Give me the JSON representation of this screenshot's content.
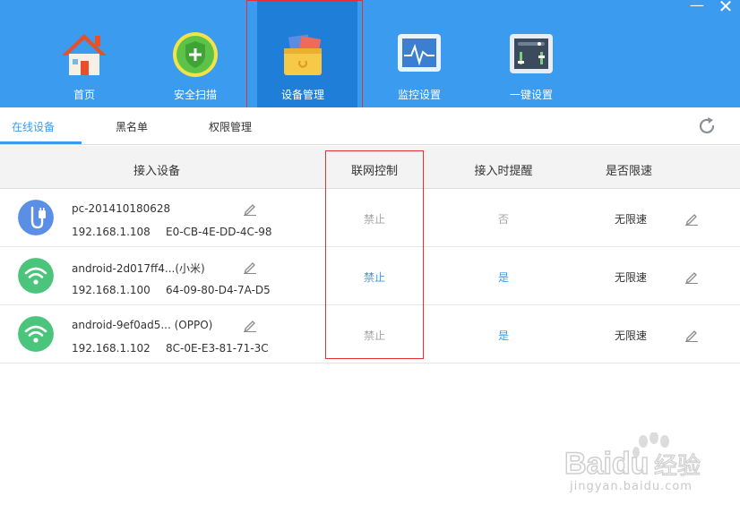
{
  "window": {
    "minimize_glyph": "—",
    "close_glyph": "✕"
  },
  "nav": {
    "home": "首页",
    "scan": "安全扫描",
    "devices": "设备管理",
    "monitor": "监控设置",
    "onekey": "一键设置",
    "active": "devices"
  },
  "subtabs": {
    "online": "在线设备",
    "blacklist": "黑名单",
    "permissions": "权限管理",
    "active": "online"
  },
  "table": {
    "headers": {
      "device": "接入设备",
      "net_control": "联网控制",
      "notify": "接入时提醒",
      "speed_limit": "是否限速"
    },
    "rows": [
      {
        "icon": "usb-plug-icon",
        "name": "pc-201410180628",
        "ip": "192.168.1.108",
        "mac": "E0-CB-4E-DD-4C-98",
        "net_control": "禁止",
        "net_state": "disabled",
        "notify": "否",
        "notify_state": "off",
        "speed": "无限速"
      },
      {
        "icon": "wifi-icon",
        "name": "android-2d017ff4...(小米)",
        "ip": "192.168.1.100",
        "mac": "64-09-80-D4-7A-D5",
        "net_control": "禁止",
        "net_state": "enabled",
        "notify": "是",
        "notify_state": "on",
        "speed": "无限速"
      },
      {
        "icon": "wifi-icon",
        "name": "android-9ef0ad5... (OPPO)",
        "ip": "192.168.1.102",
        "mac": "8C-0E-E3-81-71-3C",
        "net_control": "禁止",
        "net_state": "disabled",
        "notify": "是",
        "notify_state": "on",
        "speed": "无限速"
      }
    ]
  },
  "colors": {
    "brand_blue": "#3a9bef",
    "active_nav_bg": "#1f7fd8",
    "highlight_red": "#e33030",
    "wifi_green": "#4cc57c",
    "usb_blue": "#5b8fe6"
  },
  "watermark": {
    "logo": "Baidu经验",
    "url": "jingyan.baidu.com"
  }
}
